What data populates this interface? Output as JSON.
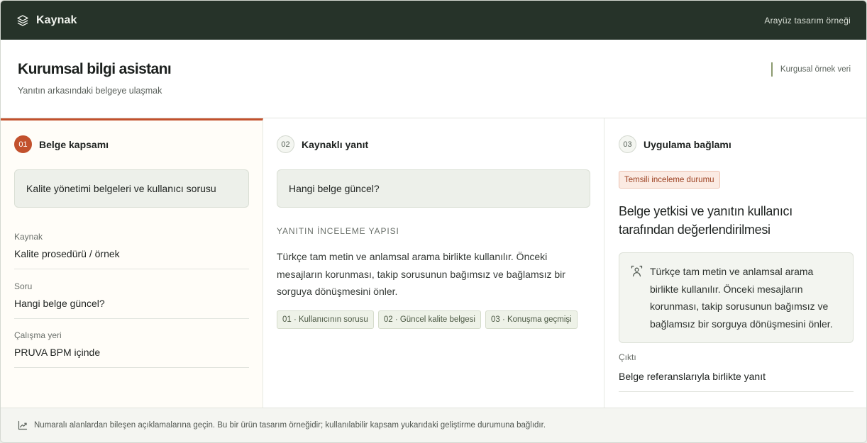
{
  "topbar": {
    "brand_icon": "layers-icon",
    "brand_name": "Kaynak",
    "right_text": "Arayüz tasarım örneği"
  },
  "header": {
    "title": "Kurumsal bilgi asistanı",
    "subtitle": "Yanıtın arkasındaki belgeye ulaşmak",
    "note": "Kurgusal örnek veri"
  },
  "columns": [
    {
      "number": "01",
      "title": "Belge kapsamı",
      "query": "Kalite yönetimi belgeleri ve kullanıcı sorusu",
      "fields": [
        {
          "label": "Kaynak",
          "value": "Kalite prosedürü / örnek"
        },
        {
          "label": "Soru",
          "value": "Hangi belge güncel?"
        },
        {
          "label": "Çalışma yeri",
          "value": "PRUVA BPM içinde"
        }
      ]
    },
    {
      "number": "02",
      "title": "Kaynaklı yanıt",
      "query": "Hangi belge güncel?",
      "section_label": "YANITIN İNCELEME YAPISI",
      "body": "Türkçe tam metin ve anlamsal arama birlikte kullanılır. Önceki mesajların korunması, takip sorusunun bağımsız ve bağlamsız bir sorguya dönüşmesini önler.",
      "chips": [
        "01 · Kullanıcının sorusu",
        "02 · Güncel kalite belgesi",
        "03 · Konuşma geçmişi"
      ]
    },
    {
      "number": "03",
      "title": "Uygulama bağlamı",
      "badge": "Temsili inceleme durumu",
      "heading": "Belge yetkisi ve yanıtın kullanıcı tarafından değerlendirilmesi",
      "note_icon": "person-focus-icon",
      "note": "Türkçe tam metin ve anlamsal arama birlikte kullanılır. Önceki mesajların korunması, takip sorusunun bağımsız ve bağlamsız bir sorguya dönüşmesini önler.",
      "output_label": "Çıktı",
      "output_value": "Belge referanslarıyla birlikte yanıt"
    }
  ],
  "footer": {
    "icon": "trend-chart-icon",
    "text": "Numaralı alanlardan bileşen açıklamalarına geçin. Bu bir ürün tasarım örneğidir; kullanılabilir kapsam yukarıdaki geliştirme durumuna bağlıdır."
  },
  "colors": {
    "topbar": "#263329",
    "accent": "#c2512d",
    "chip_bg": "#eef2e8",
    "badge_bg": "#fbebe3"
  }
}
